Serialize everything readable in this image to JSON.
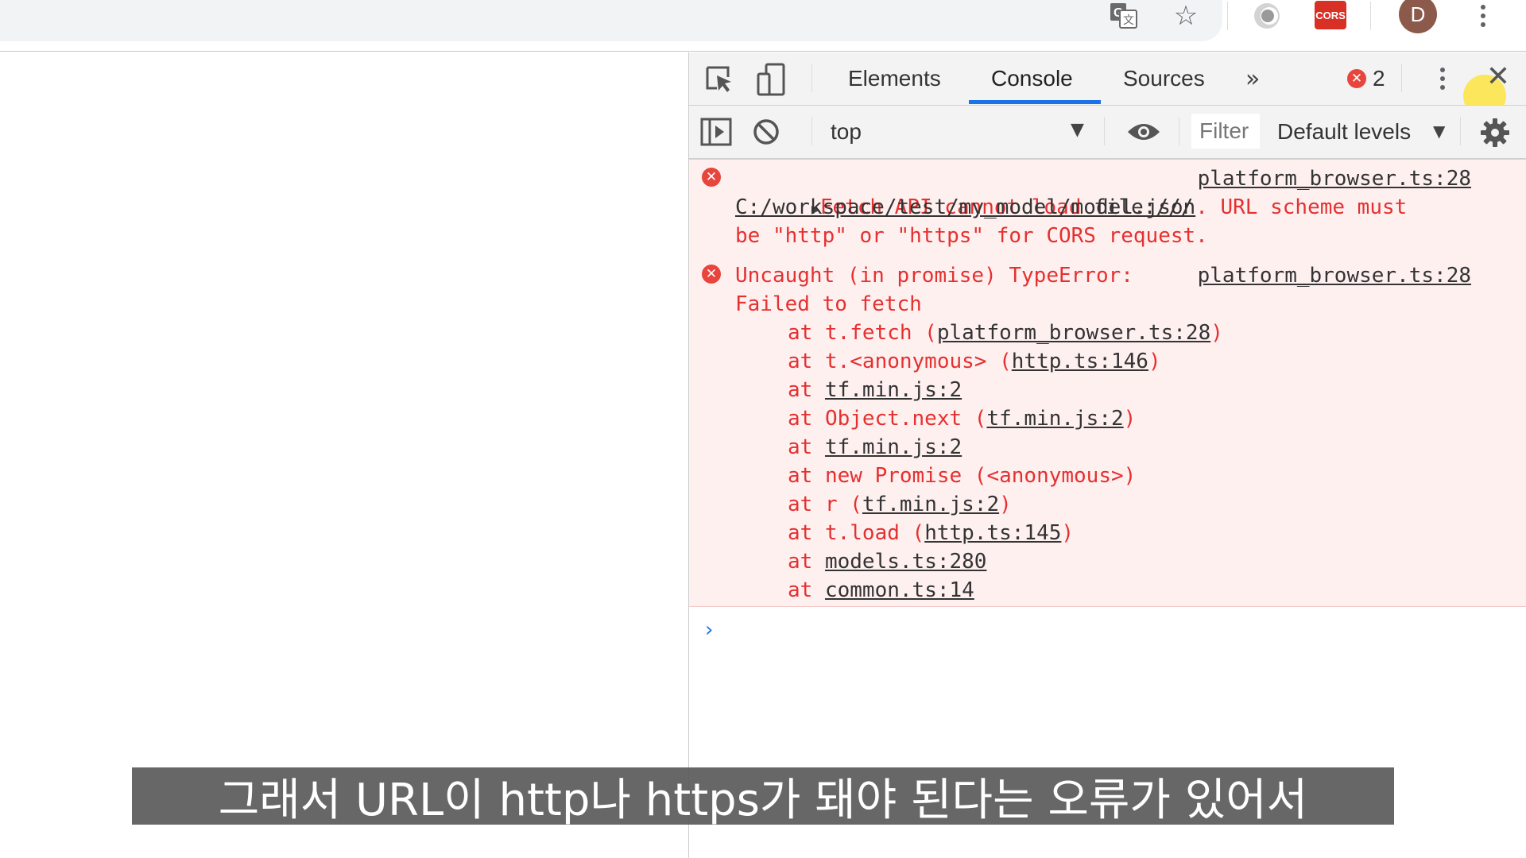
{
  "browser": {
    "avatar_letter": "D",
    "cors_extension_label": "CORS"
  },
  "devtools": {
    "tabs": [
      {
        "label": "Elements"
      },
      {
        "label": "Console"
      },
      {
        "label": "Sources"
      }
    ],
    "active_tab": "Console",
    "more_tabs": "»",
    "error_count": "2",
    "context": "top",
    "filter_placeholder": "Filter",
    "levels": "Default levels",
    "accent": "#1a73e8",
    "error_color": "#e53030"
  },
  "console": {
    "messages": [
      {
        "line1": "Fetch API cannot load ",
        "line1_link": "file:///",
        "source": "platform_browser.ts:28",
        "line2_link": "C:/workspace/test/my_model/model.json",
        "line2_rest": ". URL scheme must",
        "line3": "be \"http\" or \"https\" for CORS request."
      },
      {
        "line1": "Uncaught (in promise) TypeError:",
        "source": "platform_browser.ts:28",
        "line2": "Failed to fetch",
        "stack": [
          {
            "prefix": "at t.fetch (",
            "link": "platform_browser.ts:28",
            "suffix": ")"
          },
          {
            "prefix": "at t.<anonymous> (",
            "link": "http.ts:146",
            "suffix": ")"
          },
          {
            "prefix": "at ",
            "link": "tf.min.js:2",
            "suffix": ""
          },
          {
            "prefix": "at Object.next (",
            "link": "tf.min.js:2",
            "suffix": ")"
          },
          {
            "prefix": "at ",
            "link": "tf.min.js:2",
            "suffix": ""
          },
          {
            "prefix": "at new Promise (<anonymous>)",
            "link": "",
            "suffix": ""
          },
          {
            "prefix": "at r (",
            "link": "tf.min.js:2",
            "suffix": ")"
          },
          {
            "prefix": "at t.load (",
            "link": "http.ts:145",
            "suffix": ")"
          },
          {
            "prefix": "at ",
            "link": "models.ts:280",
            "suffix": ""
          },
          {
            "prefix": "at ",
            "link": "common.ts:14",
            "suffix": ""
          }
        ]
      }
    ],
    "prompt": "›"
  },
  "subtitle": "그래서 URL이 http나 https가 돼야 된다는 오류가 있어서"
}
